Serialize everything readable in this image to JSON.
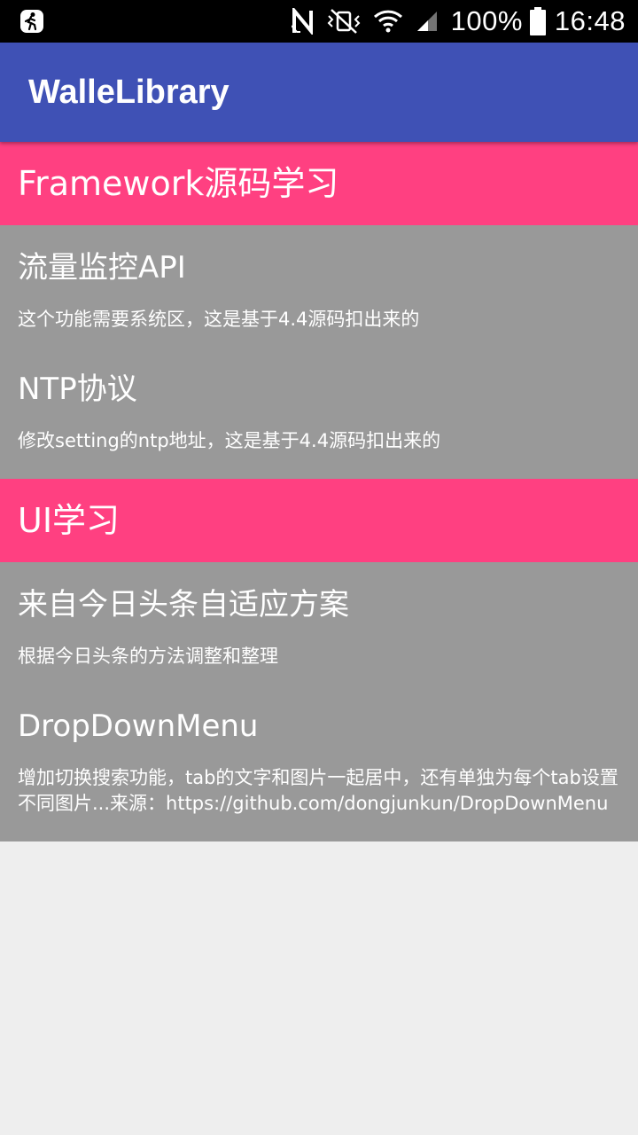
{
  "status_bar": {
    "battery": "100%",
    "time": "16:48",
    "icons": [
      "runner-icon",
      "nfc-icon",
      "vibrate-icon",
      "wifi-icon",
      "signal-icon",
      "battery-icon"
    ]
  },
  "app_bar": {
    "title": "WalleLibrary",
    "color": "#3F51B5"
  },
  "sections": [
    {
      "header": "Framework源码学习",
      "items": [
        {
          "title": "流量监控API",
          "description": "这个功能需要系统区，这是基于4.4源码扣出来的"
        },
        {
          "title": "NTP协议",
          "description": "修改setting的ntp地址，这是基于4.4源码扣出来的"
        }
      ]
    },
    {
      "header": "UI学习",
      "items": [
        {
          "title": "来自今日头条自适应方案",
          "description": "根据今日头条的方法调整和整理"
        },
        {
          "title": "DropDownMenu",
          "description": "增加切换搜索功能，tab的文字和图片一起居中，还有单独为每个tab设置不同图片...来源：https://github.com/dongjunkun/DropDownMenu"
        }
      ]
    }
  ],
  "colors": {
    "header": "#FF4081",
    "item_background": "#999999",
    "page_background": "#EEEEEE"
  }
}
